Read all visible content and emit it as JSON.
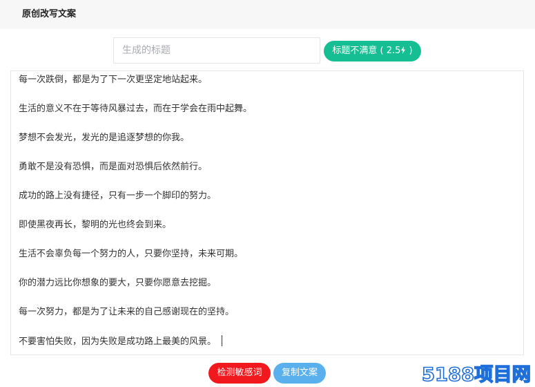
{
  "header": {
    "title": "原创改写文案"
  },
  "title_bar": {
    "placeholder": "生成的标题",
    "value": "",
    "retry_label": "标题不满意 ( 2.5",
    "retry_suffix": " )"
  },
  "content": {
    "lines": [
      "每一次跌倒，都是为了下一次更坚定地站起来。",
      "生活的意义不在于等待风暴过去，而在于学会在雨中起舞。",
      "梦想不会发光，发光的是追逐梦想的你我。",
      "勇敢不是没有恐惧，而是面对恐惧后依然前行。",
      "成功的路上没有捷径，只有一步一个脚印的努力。",
      "即使黑夜再长，黎明的光也终会到来。",
      "生活不会辜负每一个努力的人，只要你坚持，未来可期。",
      "你的潜力远比你想象的要大，只要你愿意去挖掘。",
      "每一次努力，都是为了让未来的自己感谢现在的坚持。",
      "不要害怕失败，因为失败是成功路上最美的风景。"
    ]
  },
  "actions": {
    "detect_label": "检测敏感词",
    "copy_label": "复制文案"
  },
  "watermark": {
    "text": "5188项目网"
  },
  "colors": {
    "retry": "#16bf93",
    "detect": "#f1191e",
    "copy": "#5ab0ec",
    "watermark": "#1e6fd9"
  },
  "icons": {
    "retry": "lightning-bolt-icon"
  }
}
